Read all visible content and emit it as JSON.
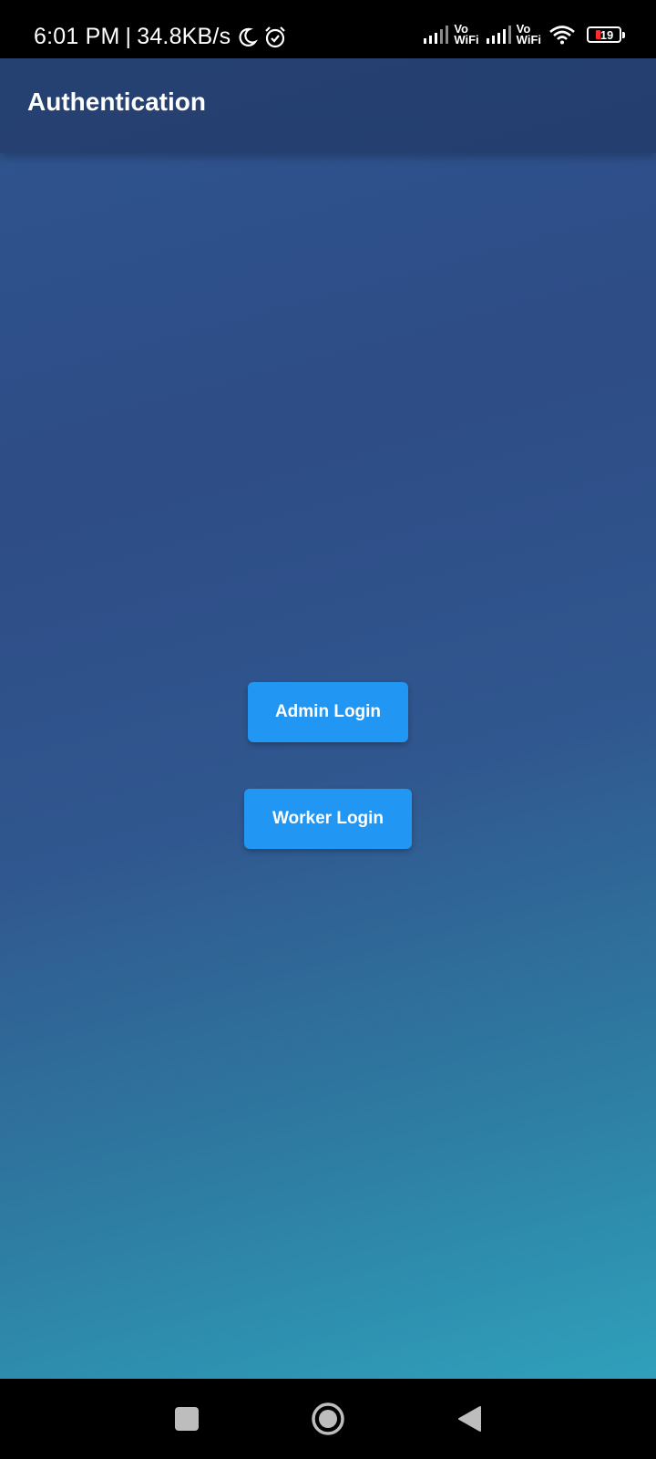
{
  "status_bar": {
    "time": "6:01 PM",
    "separator": "|",
    "net_speed": "34.8KB/s",
    "vowifi_1_top": "Vo",
    "vowifi_1_bottom": "WiFi",
    "vowifi_2_top": "Vo",
    "vowifi_2_bottom": "WiFi",
    "battery_level": "19",
    "icons": [
      "moon-icon",
      "alarm-icon",
      "signal-icon",
      "signal-icon",
      "wifi-icon",
      "battery-icon"
    ]
  },
  "app_bar": {
    "title": "Authentication"
  },
  "actions": {
    "admin_label": "Admin Login",
    "worker_label": "Worker Login"
  },
  "nav_bar": {
    "icons": [
      "recent-apps-icon",
      "home-icon",
      "back-icon"
    ]
  },
  "colors": {
    "button": "#2196f3",
    "gradient_top": "#2f5590",
    "gradient_bottom": "#2fa0bb",
    "battery_low": "#ff2b2b"
  }
}
